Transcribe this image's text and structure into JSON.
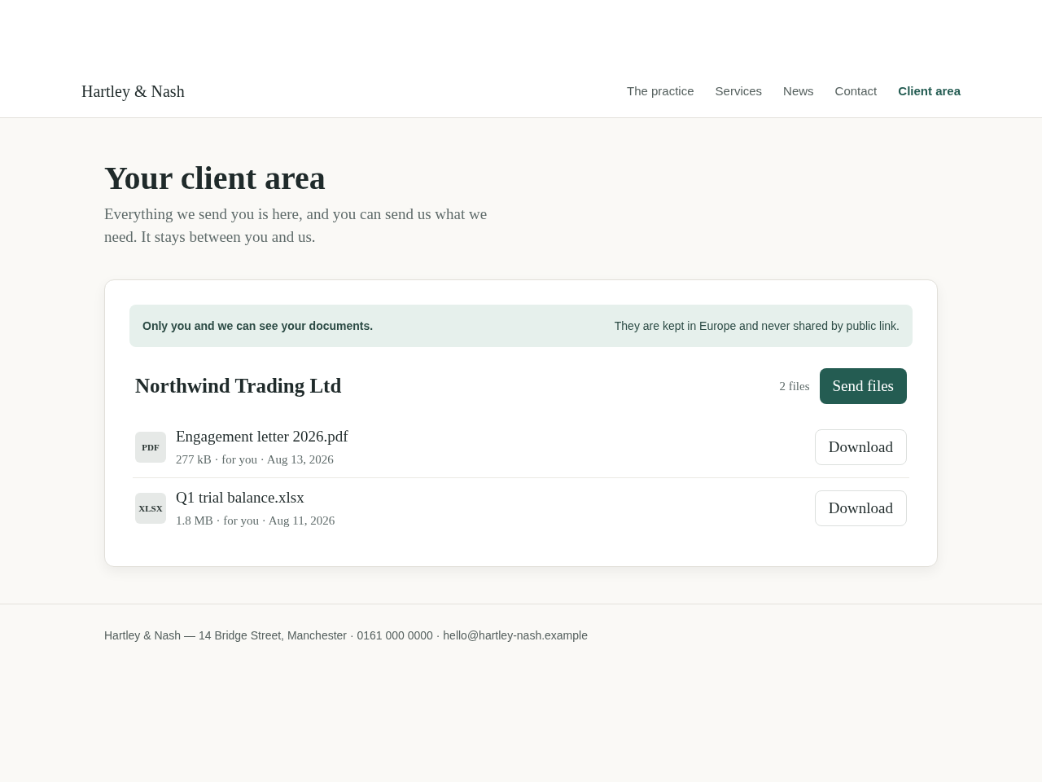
{
  "header": {
    "logo": "Hartley & Nash",
    "nav": [
      {
        "label": "The practice",
        "selected": false
      },
      {
        "label": "Services",
        "selected": false
      },
      {
        "label": "News",
        "selected": false
      },
      {
        "label": "Contact",
        "selected": false
      },
      {
        "label": "Client area",
        "selected": true
      }
    ]
  },
  "page": {
    "title": "Your client area",
    "intro": "Everything we send you is here, and you can send us what we need. It stays between you and us."
  },
  "notice": {
    "primary": "Only you and we can see your documents.",
    "secondary": "They are kept in Europe and never shared by public link."
  },
  "client": {
    "name": "Northwind Trading Ltd",
    "file_count": "2 files",
    "send_button": "Send files"
  },
  "files": [
    {
      "type": "PDF",
      "name": "Engagement letter 2026.pdf",
      "meta": "277 kB · for you · Aug 13, 2026",
      "action": "Download"
    },
    {
      "type": "XLSX",
      "name": "Q1 trial balance.xlsx",
      "meta": "1.8 MB · for you · Aug 11, 2026",
      "action": "Download"
    }
  ],
  "footer": {
    "text": "Hartley & Nash — 14 Bridge Street, Manchester · 0161 000 0000 · hello@hartley-nash.example"
  }
}
